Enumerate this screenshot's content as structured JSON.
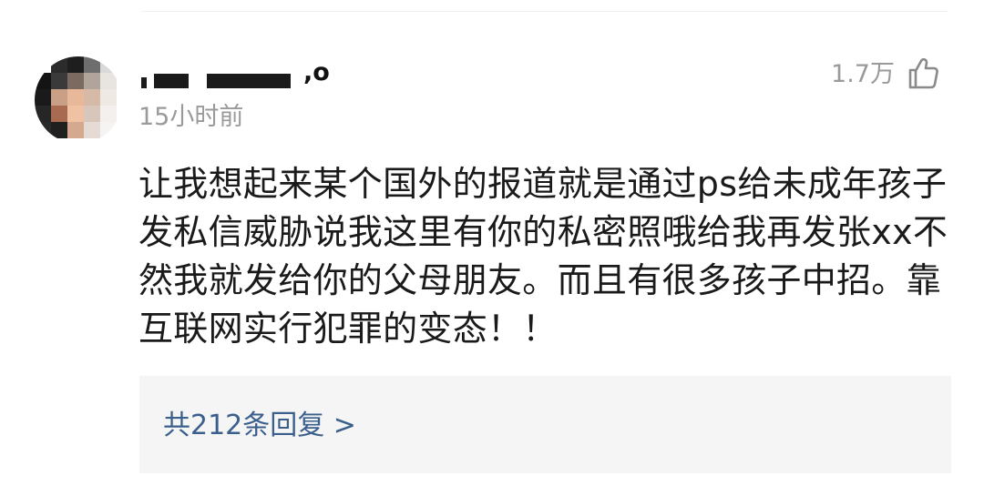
{
  "comment": {
    "username_suffix": ",o",
    "timestamp": "15小时前",
    "like_count": "1.7万",
    "body": "让我想起来某个国外的报道就是通过ps给未成年孩子发私信威胁说我这里有你的私密照哦给我再发张xx不然我就发给你的父母朋友。而且有很多孩子中招。靠互联网实行犯罪的变态！！",
    "replies_label": "共212条回复 >"
  },
  "icons": {
    "like": "thumbs-up-icon"
  },
  "colors": {
    "text": "#1a1a1a",
    "muted": "#9a9a9a",
    "link": "#3b5f8c",
    "reply_bg": "#f5f5f5"
  }
}
